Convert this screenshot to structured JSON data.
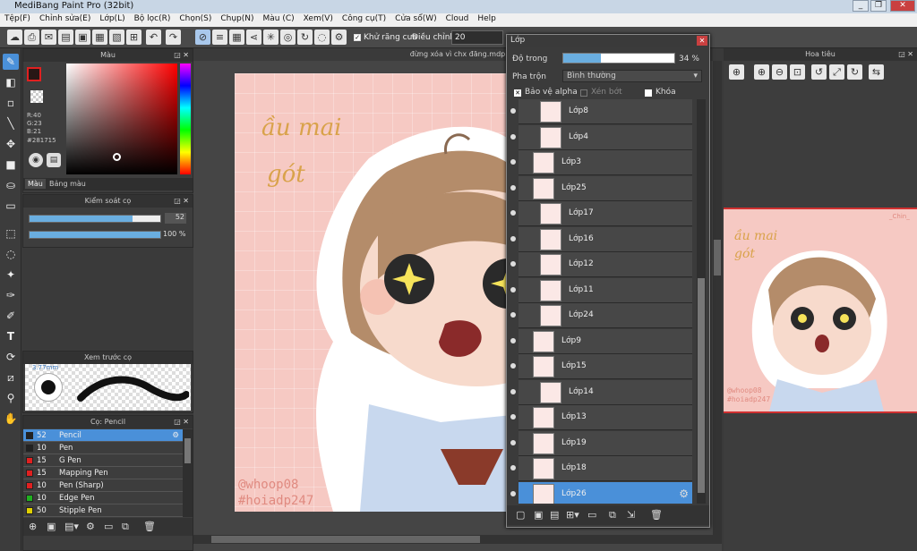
{
  "app": {
    "title": "MediBang Paint Pro (32bit)",
    "colors": {
      "accent": "#4a90d9",
      "canvas_bg": "#f6c9c3"
    }
  },
  "menu": [
    "Tệp(F)",
    "Chỉnh sửa(E)",
    "Lớp(L)",
    "Bộ lọc(R)",
    "Chọn(S)",
    "Chụp(N)",
    "Màu (C)",
    "Xem(V)",
    "Công cụ(T)",
    "Cửa sổ(W)",
    "Cloud",
    "Help"
  ],
  "toolbar": {
    "antialias": "Khử răng cưa",
    "adjust": "Điều chỉnh",
    "adjust_value": "20"
  },
  "color_panel": {
    "title": "Màu",
    "r": "R:40",
    "g": "G:23",
    "b": "B:21",
    "hex": "#281715",
    "tab1": "Màu",
    "tab2": "Bảng màu"
  },
  "brush_control": {
    "title": "Kiểm soát cọ",
    "size": "52",
    "opacity": "100 %",
    "size_frac": 0.79,
    "opacity_frac": 1.0
  },
  "preview": {
    "title": "Xem trước cọ",
    "size_label": "3.77mm"
  },
  "brush_list": {
    "title": "Cọ: Pencil",
    "items": [
      {
        "num": "52",
        "name": "Pencil",
        "color": "#222222",
        "selected": true
      },
      {
        "num": "10",
        "name": "Pen",
        "color": "#222222"
      },
      {
        "num": "15",
        "name": "G Pen",
        "color": "#e02020"
      },
      {
        "num": "15",
        "name": "Mapping Pen",
        "color": "#e02020"
      },
      {
        "num": "10",
        "name": "Pen (Sharp)",
        "color": "#e02020"
      },
      {
        "num": "10",
        "name": "Edge Pen",
        "color": "#20b020"
      },
      {
        "num": "50",
        "name": "Stipple Pen",
        "color": "#e0d000"
      }
    ]
  },
  "canvas": {
    "filename": "đừng xóa vì chx đăng.mdp",
    "handwriting_1": "ầu mai",
    "handwriting_2": "gót",
    "watermark_1": "@whoop08",
    "watermark_2": "#hoiadp247"
  },
  "layers": {
    "title": "Lớp",
    "opacity_label": "Độ trong",
    "opacity_value": "34 %",
    "opacity_frac": 0.34,
    "blend_label": "Pha trộn",
    "blend_value": "Bình thường",
    "protect_alpha": "Bảo vệ alpha",
    "clip": "Xén bớt",
    "lock": "Khóa",
    "items": [
      {
        "name": "Lớp8",
        "indent": true
      },
      {
        "name": "Lớp4",
        "indent": true
      },
      {
        "name": "Lớp3",
        "indent": false
      },
      {
        "name": "Lớp25",
        "indent": false
      },
      {
        "name": "Lớp17",
        "indent": true
      },
      {
        "name": "Lớp16",
        "indent": true
      },
      {
        "name": "Lớp12",
        "indent": true
      },
      {
        "name": "Lớp11",
        "indent": true
      },
      {
        "name": "Lớp24",
        "indent": true
      },
      {
        "name": "Lớp9",
        "indent": false
      },
      {
        "name": "Lớp15",
        "indent": false
      },
      {
        "name": "Lớp14",
        "indent": true
      },
      {
        "name": "Lớp13",
        "indent": false
      },
      {
        "name": "Lớp19",
        "indent": false
      },
      {
        "name": "Lớp18",
        "indent": false
      },
      {
        "name": "Lớp26",
        "indent": false,
        "selected": true
      }
    ]
  },
  "navigator": {
    "title": "Hoa tiêu",
    "handwriting": "ầu mai gót",
    "watermark_1": "@whoop08",
    "watermark_2": "#hoiadp247",
    "corner": "_Chin_"
  }
}
